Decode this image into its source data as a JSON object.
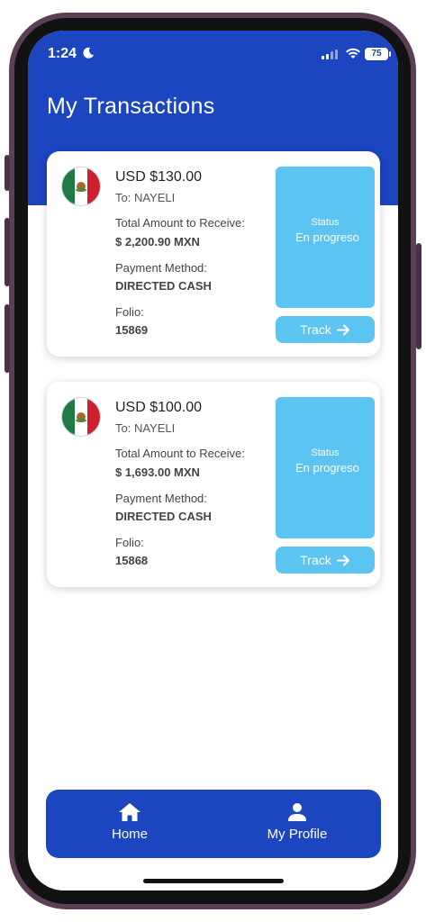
{
  "status_bar": {
    "time": "1:24",
    "battery": "75"
  },
  "header": {
    "title": "My Transactions"
  },
  "transactions": [
    {
      "amount": "USD $130.00",
      "recipient": "To: NAYELI",
      "total_label": "Total Amount to Receive:",
      "total_value": "$ 2,200.90 MXN",
      "payment_label": "Payment Method:",
      "payment_value": "DIRECTED CASH",
      "folio_label": "Folio:",
      "folio_value": "15869",
      "status_label": "Status",
      "status_value": "En progreso",
      "track_label": "Track"
    },
    {
      "amount": "USD $100.00",
      "recipient": "To: NAYELI",
      "total_label": "Total Amount to Receive:",
      "total_value": "$ 1,693.00 MXN",
      "payment_label": "Payment Method:",
      "payment_value": "DIRECTED CASH",
      "folio_label": "Folio:",
      "folio_value": "15868",
      "status_label": "Status",
      "status_value": "En progreso",
      "track_label": "Track"
    }
  ],
  "nav": {
    "home_label": "Home",
    "profile_label": "My Profile"
  },
  "icons": {
    "flag": "mexico-flag-icon",
    "track": "arrow-right-icon",
    "home": "home-icon",
    "profile": "person-icon"
  },
  "colors": {
    "primary": "#1c45c0",
    "status": "#5bc4f0"
  }
}
